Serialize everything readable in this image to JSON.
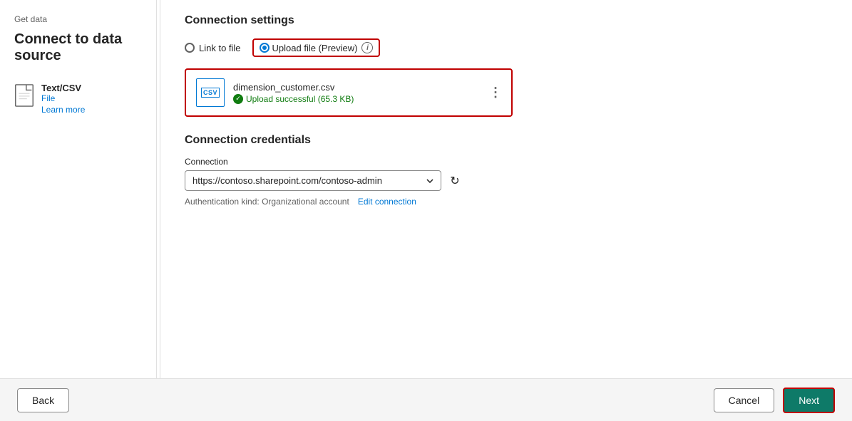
{
  "breadcrumb": "Get data",
  "page_title": "Connect to data source",
  "sidebar": {
    "file_type": "Text/CSV",
    "file_label": "File",
    "learn_more": "Learn more"
  },
  "connection_settings": {
    "section_title": "Connection settings",
    "link_to_file_label": "Link to file",
    "upload_file_label": "Upload file (Preview)",
    "info_icon_label": "i",
    "file": {
      "name": "dimension_customer.csv",
      "status": "Upload successful (65.3 KB)"
    }
  },
  "connection_credentials": {
    "section_title": "Connection credentials",
    "connection_label": "Connection",
    "connection_value": "https://contoso.sharepoint.com/contoso-admin",
    "auth_kind_label": "Authentication kind: Organizational account",
    "edit_connection_label": "Edit connection"
  },
  "footer": {
    "back_label": "Back",
    "cancel_label": "Cancel",
    "next_label": "Next"
  }
}
